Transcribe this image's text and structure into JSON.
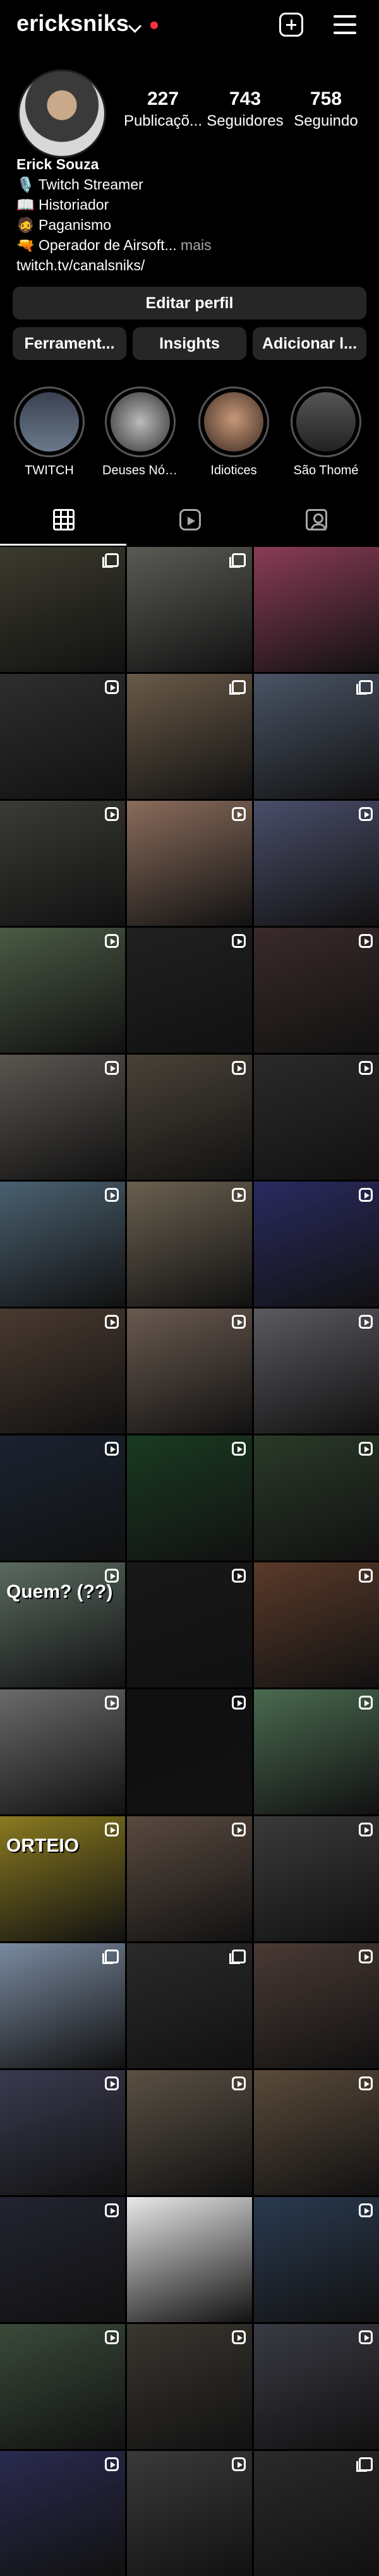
{
  "header": {
    "username": "ericksniks"
  },
  "stats": [
    {
      "value": "227",
      "label": "Publicaçõ..."
    },
    {
      "value": "743",
      "label": "Seguidores"
    },
    {
      "value": "758",
      "label": "Seguindo"
    }
  ],
  "bio": {
    "name": "Erick Souza",
    "lines": [
      "🎙️ Twitch Streamer",
      "📖 Historiador",
      "🧔 Paganismo",
      "🔫 Operador de Airsoft..."
    ],
    "more": "mais",
    "link": "twitch.tv/canalsniks/"
  },
  "buttons": {
    "edit_profile": "Editar perfil",
    "tools": "Ferrament...",
    "insights": "Insights",
    "add": "Adicionar l..."
  },
  "highlights": [
    {
      "label": "TWITCH"
    },
    {
      "label": "Deuses Nórdi..."
    },
    {
      "label": "Idiotices"
    },
    {
      "label": "São Thomé"
    }
  ],
  "posts": [
    {
      "bg": "#3b3b2e",
      "badge": "multi"
    },
    {
      "bg": "#5a5a55",
      "badge": "multi"
    },
    {
      "bg": "#8a3c55",
      "badge": "none"
    },
    {
      "bg": "#2e2e2e",
      "badge": "reel"
    },
    {
      "bg": "#6a5a48",
      "badge": "multi"
    },
    {
      "bg": "#4a5466",
      "badge": "multi"
    },
    {
      "bg": "#3a3a36",
      "badge": "reel"
    },
    {
      "bg": "#8a6c5c",
      "badge": "reel"
    },
    {
      "bg": "#4a4e6a",
      "badge": "reel"
    },
    {
      "bg": "#4a5a44",
      "badge": "reel"
    },
    {
      "bg": "#202020",
      "badge": "reel"
    },
    {
      "bg": "#3a2a2a",
      "badge": "reel"
    },
    {
      "bg": "#5a5550",
      "badge": "reel"
    },
    {
      "bg": "#4a4238",
      "badge": "reel"
    },
    {
      "bg": "#2a2a2a",
      "badge": "reel"
    },
    {
      "bg": "#4a6070",
      "badge": "reel"
    },
    {
      "bg": "#6a6050",
      "badge": "reel"
    },
    {
      "bg": "#2a2a60",
      "badge": "reel"
    },
    {
      "bg": "#4a3a30",
      "badge": "reel"
    },
    {
      "bg": "#6a5a50",
      "badge": "reel"
    },
    {
      "bg": "#5a5a60",
      "badge": "reel"
    },
    {
      "bg": "#1a2230",
      "badge": "reel"
    },
    {
      "bg": "#1a3a22",
      "badge": "reel"
    },
    {
      "bg": "#2a3a28",
      "badge": "reel"
    },
    {
      "bg": "#5a6a60",
      "badge": "reel",
      "text": "Quem? (??)"
    },
    {
      "bg": "#181818",
      "badge": "reel"
    },
    {
      "bg": "#5a3a2a",
      "badge": "reel"
    },
    {
      "bg": "#6a6a6a",
      "badge": "reel"
    },
    {
      "bg": "#101010",
      "badge": "reel"
    },
    {
      "bg": "#4a6a50",
      "badge": "reel"
    },
    {
      "bg": "#8a7a20",
      "badge": "reel",
      "text": "ORTEIO"
    },
    {
      "bg": "#5a4a40",
      "badge": "reel"
    },
    {
      "bg": "#3a3a3a",
      "badge": "reel"
    },
    {
      "bg": "#7a8aa0",
      "badge": "multi"
    },
    {
      "bg": "#2a2a2a",
      "badge": "multi"
    },
    {
      "bg": "#4a3a34",
      "badge": "reel"
    },
    {
      "bg": "#3a3a50",
      "badge": "reel"
    },
    {
      "bg": "#5a5044",
      "badge": "reel"
    },
    {
      "bg": "#5a4a3a",
      "badge": "reel"
    },
    {
      "bg": "#222430",
      "badge": "reel"
    },
    {
      "bg": "#e8e8e8",
      "badge": "none"
    },
    {
      "bg": "#2a3a50",
      "badge": "reel"
    },
    {
      "bg": "#3a4a3a",
      "badge": "reel"
    },
    {
      "bg": "#3a3630",
      "badge": "reel"
    },
    {
      "bg": "#3a3a44",
      "badge": "reel"
    },
    {
      "bg": "#2a2a50",
      "badge": "reel"
    },
    {
      "bg": "#3a3a3a",
      "badge": "reel"
    },
    {
      "bg": "#2a2a2a",
      "badge": "multi"
    }
  ]
}
